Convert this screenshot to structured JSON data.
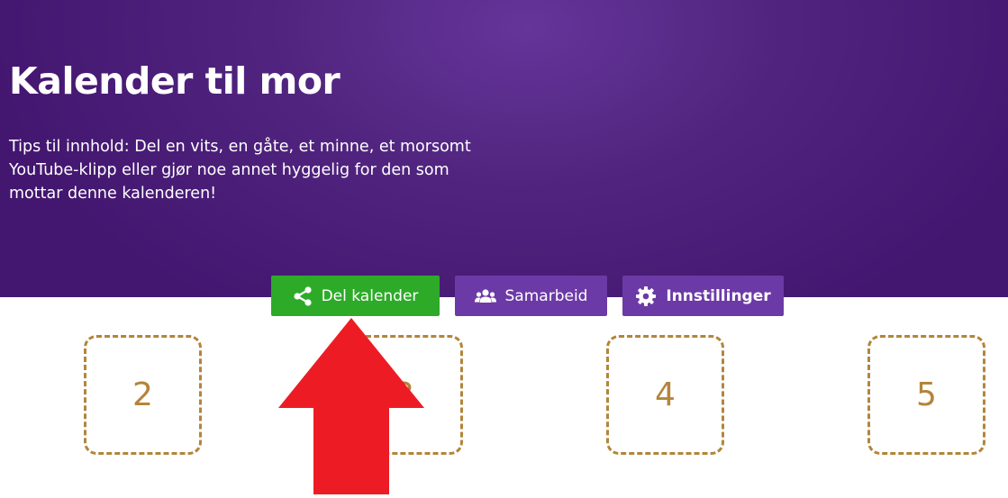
{
  "header": {
    "title": "Kalender til mor",
    "description": "Tips til innhold: Del en vits, en gåte, et minne, et morsomt YouTube-klipp eller gjør noe annet hyggelig for den som mottar denne kalenderen!"
  },
  "actions": {
    "share": {
      "label": "Del kalender",
      "icon": "share-icon",
      "color": "#2eaa29"
    },
    "collaborate": {
      "label": "Samarbeid",
      "icon": "users-icon",
      "color": "#6c3aa6"
    },
    "settings": {
      "label": "Innstillinger",
      "icon": "gear-icon",
      "color": "#6c3aa6"
    }
  },
  "doors": [
    {
      "number": "2"
    },
    {
      "number": "3"
    },
    {
      "number": "4"
    },
    {
      "number": "5"
    }
  ],
  "colors": {
    "hero_background": "#51257f",
    "door_border": "#b3853a",
    "annotation_arrow": "#ed1c24"
  }
}
